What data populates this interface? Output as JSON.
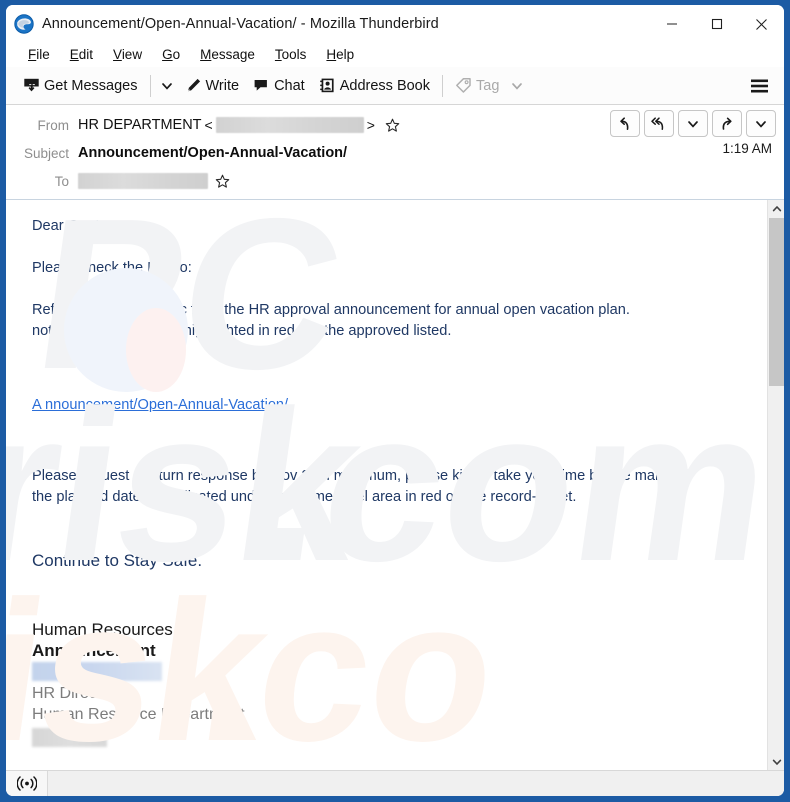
{
  "window": {
    "title": "Announcement/Open-Annual-Vacation/ - Mozilla Thunderbird",
    "app_icon": "thunderbird-icon",
    "frame_color": "#1c5ba4",
    "controls": {
      "minimize": "minimize-icon",
      "maximize": "maximize-icon",
      "close": "close-icon"
    }
  },
  "menu_bar": {
    "items": [
      {
        "label": "File",
        "accel": "F"
      },
      {
        "label": "Edit",
        "accel": "E"
      },
      {
        "label": "View",
        "accel": "V"
      },
      {
        "label": "Go",
        "accel": "G"
      },
      {
        "label": "Message",
        "accel": "M"
      },
      {
        "label": "Tools",
        "accel": "T"
      },
      {
        "label": "Help",
        "accel": "H"
      }
    ]
  },
  "toolbar": {
    "get_messages_label": "Get Messages",
    "get_messages_icon": "get-messages-icon",
    "get_messages_dropdown_icon": "chevron-down-icon",
    "write_label": "Write",
    "write_icon": "pencil-icon",
    "chat_label": "Chat",
    "chat_icon": "chat-bubble-icon",
    "address_book_label": "Address Book",
    "address_book_icon": "address-book-icon",
    "tag_label": "Tag",
    "tag_icon": "tag-icon",
    "tag_dropdown_icon": "chevron-down-icon",
    "tag_disabled": true,
    "app_menu_icon": "hamburger-menu-icon"
  },
  "message_header": {
    "from_label": "From",
    "from_name": "HR DEPARTMENT",
    "from_email_redacted": true,
    "angle_open": "<",
    "angle_close": ">",
    "from_star_icon": "star-icon",
    "subject_label": "Subject",
    "subject_value": "Announcement/Open-Annual-Vacation/",
    "to_label": "To",
    "to_value_redacted": true,
    "to_star_icon": "star-icon",
    "time": "1:19 AM",
    "actions": [
      {
        "name": "reply-button",
        "icon": "reply-arrow-icon"
      },
      {
        "name": "reply-all-button",
        "icon": "reply-all-arrow-icon"
      },
      {
        "name": "reply-dropdown-button",
        "icon": "chevron-down-icon"
      },
      {
        "name": "forward-button",
        "icon": "forward-arrow-icon"
      },
      {
        "name": "more-actions-dropdown-button",
        "icon": "chevron-down-icon"
      }
    ]
  },
  "message_body": {
    "greeting": "Dear Gents,",
    "memo_line": "Please check the Memo:",
    "paragraph_1_line_1": "Refer to the above topic from the HR approval announcement for annual open vacation plan.",
    "paragraph_1_line_2": "note that all the names highlighted in red are the approved listed.",
    "link_text": "A nnouncement/Open-Annual-Vacation/",
    "paragraph_2_line_1": "Please request a return response by  Nov 28th maximum, please kindly take your time before marking",
    "paragraph_2_line_2": "the planned date, as indicated under the name label area in red on the record-sheet.",
    "closing": "Continue to Stay Safe.",
    "text_color": "#1f3864",
    "link_color": "#2b6ed8",
    "watermark_text": "PCrisk.com"
  },
  "signature": {
    "line_1": "Human Resources",
    "line_2": "Announcement",
    "name_redacted": true,
    "title": "HR Director",
    "department": "Human Resource Department",
    "footer_redacted": true
  },
  "scrollbar": {
    "up_icon": "chevron-up-icon",
    "down_icon": "chevron-down-icon",
    "thumb_position_percent": 3,
    "thumb_size_percent": 30
  },
  "status_bar": {
    "icon": "broadcast-icon",
    "text": ""
  }
}
